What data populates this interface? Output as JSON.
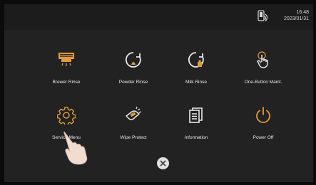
{
  "status": {
    "time": "16:48",
    "date": "2023/01/31"
  },
  "menu": {
    "items": [
      {
        "label": "Brewer Rinse",
        "icon": "brewer-rinse-icon"
      },
      {
        "label": "Powder Rinse",
        "icon": "powder-rinse-icon"
      },
      {
        "label": "Milk Rinse",
        "icon": "milk-rinse-icon"
      },
      {
        "label": "One-Button Maint.",
        "icon": "touch-icon"
      },
      {
        "label": "Service Menu",
        "icon": "gear-icon"
      },
      {
        "label": "Wipe Protect",
        "icon": "wipe-icon"
      },
      {
        "label": "Information",
        "icon": "document-icon"
      },
      {
        "label": "Power Off",
        "icon": "power-icon"
      }
    ]
  },
  "colors": {
    "accent": "#f2a33a",
    "background": "#222222",
    "text": "#e8e8e8"
  }
}
